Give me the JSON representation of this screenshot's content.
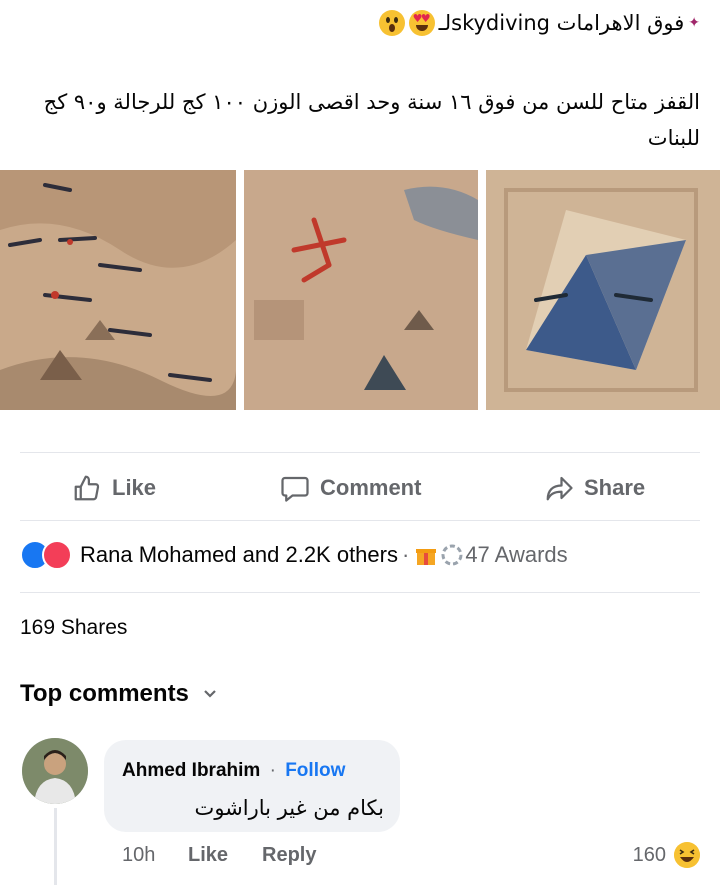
{
  "post": {
    "title_main": "فوق الاهرامات skydivingلـ",
    "description": "القفز متاح للسن من فوق ١٦ سنة وحد اقصى الوزن ١٠٠ كج للرجالة و٩٠ كج للبنات",
    "title_emojis": [
      "sparkle-icon",
      "heart-eyes-emoji",
      "surprised-emoji"
    ]
  },
  "actions": {
    "like": "Like",
    "comment": "Comment",
    "share": "Share"
  },
  "reactions": {
    "summary": "Rana Mohamed and 2.2K others",
    "separator": "·",
    "awards": "47 Awards"
  },
  "shares": "169 Shares",
  "comments": {
    "header": "Top comments",
    "items": [
      {
        "author": "Ahmed Ibrahim",
        "dot": "·",
        "follow": "Follow",
        "text": "بكام من غير باراشوت",
        "time": "10h",
        "like": "Like",
        "reply": "Reply",
        "reaction_count": "160"
      }
    ]
  },
  "colors": {
    "accent": "#1877f2",
    "muted": "#65676b",
    "bubble": "#f0f2f5"
  }
}
